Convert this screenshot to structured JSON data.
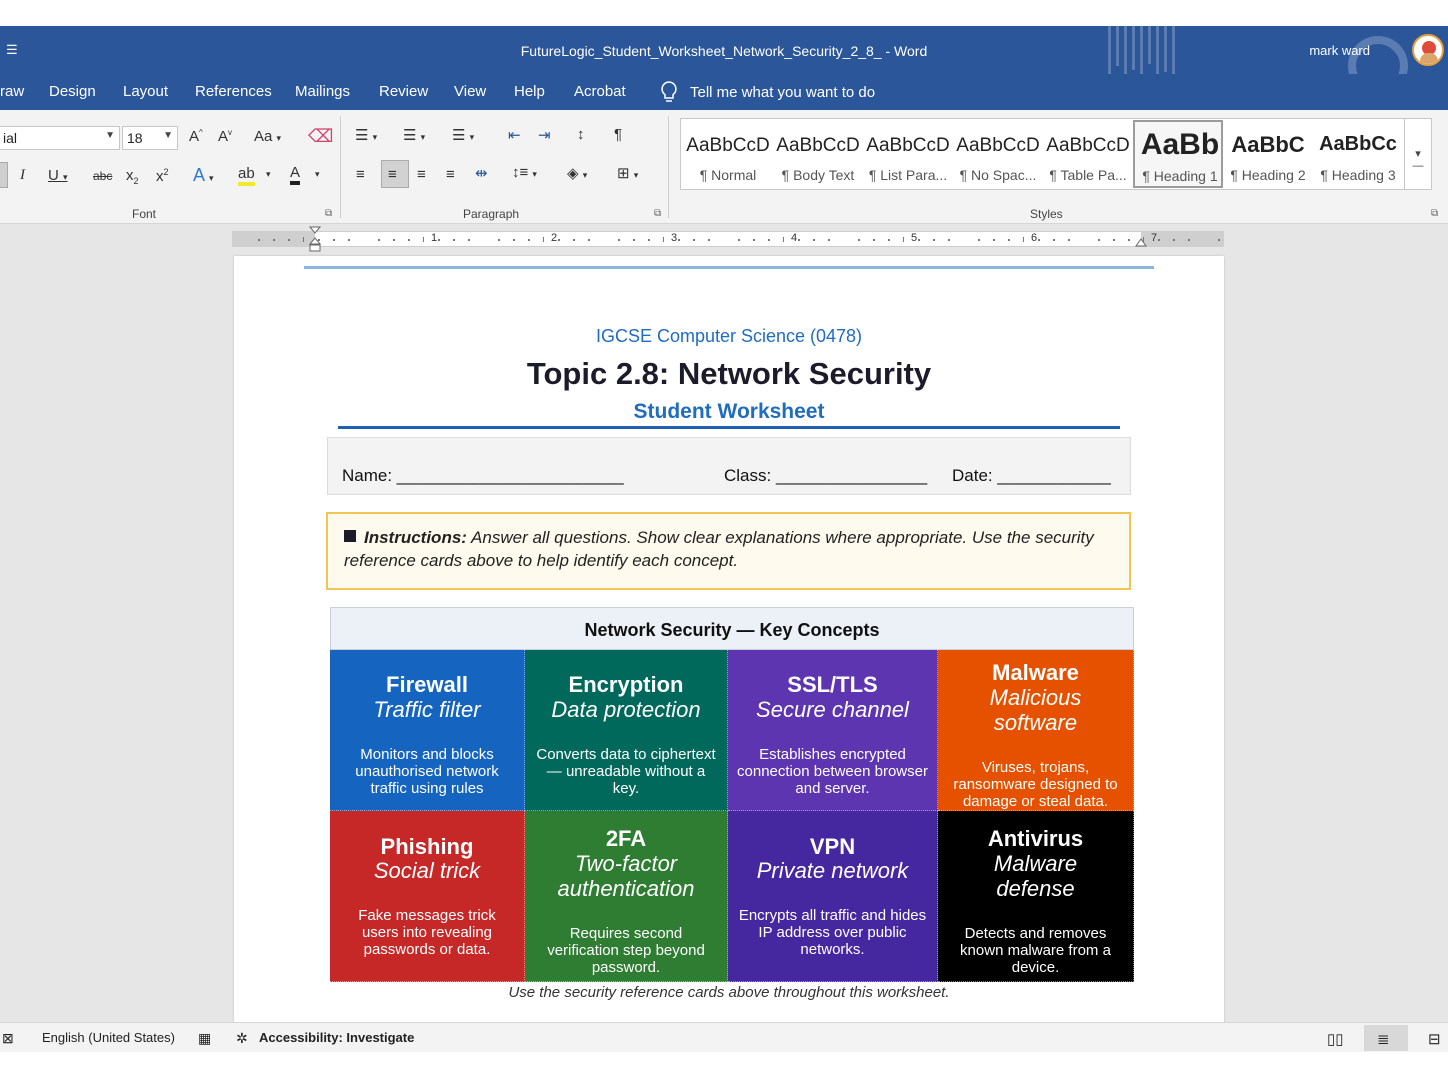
{
  "window": {
    "qat_glyph": "☰",
    "title": "FutureLogic_Student_Worksheet_Network_Security_2_8_  -  Word",
    "user_name": "mark ward"
  },
  "menu": {
    "tabs": [
      "raw",
      "Design",
      "Layout",
      "References",
      "Mailings",
      "Review",
      "View",
      "Help",
      "Acrobat"
    ],
    "tell_me": "Tell me what you want to do"
  },
  "ribbon": {
    "font_name": "ial",
    "font_size": "18",
    "font_group_label": "Font",
    "paragraph_group_label": "Paragraph",
    "styles_group_label": "Styles",
    "styles": [
      {
        "sample": "AaBbCcD",
        "name": "¶ Normal"
      },
      {
        "sample": "AaBbCcD",
        "name": "¶ Body Text"
      },
      {
        "sample": "AaBbCcD",
        "name": "¶ List Para..."
      },
      {
        "sample": "AaBbCcD",
        "name": "¶ No Spac..."
      },
      {
        "sample": "AaBbCcD",
        "name": "¶ Table Pa..."
      },
      {
        "sample": "AaBb",
        "name": "¶ Heading 1"
      },
      {
        "sample": "AaBbC",
        "name": "¶ Heading 2"
      },
      {
        "sample": "AaBbCc",
        "name": "¶ Heading 3"
      }
    ],
    "selected_style_index": 5
  },
  "ruler": {
    "numbers": [
      "1",
      "2",
      "3",
      "4",
      "5",
      "6",
      "7"
    ]
  },
  "document": {
    "course": "IGCSE Computer Science (0478)",
    "topic": "Topic 2.8: Network Security",
    "subtitle": "Student Worksheet",
    "name_label": "Name: ________________________",
    "class_label": "Class: ________________",
    "date_label": "Date: ____________",
    "instructions_bold": "Instructions:",
    "instructions_text": " Answer all questions. Show clear explanations where appropriate. Use the security reference cards above to help identify each concept.",
    "table_header": "Network Security — Key Concepts",
    "cards": [
      {
        "name": "Firewall",
        "sub": "Traffic filter",
        "desc": "Monitors and blocks unauthorised  network traffic using rules",
        "color": "#1565c0"
      },
      {
        "name": "Encryption",
        "sub": "Data protection",
        "desc": "Converts data to ciphertext  —  unreadable without a key.",
        "color": "#00695c"
      },
      {
        "name": "SSL/TLS",
        "sub": "Secure channel",
        "desc": "Establishes encrypted connection  between browser and server.",
        "color": "#5e35b1"
      },
      {
        "name": "Malware",
        "sub": "Malicious software",
        "desc": "Viruses, trojans, ransomware designed to damage or steal data.",
        "color": "#e65100"
      },
      {
        "name": "Phishing",
        "sub": "Social trick",
        "desc": "Fake messages trick users into  revealing passwords or data.",
        "color": "#c62828"
      },
      {
        "name": "2FA",
        "sub": "Two-factor authentication",
        "desc": "Requires second verification step  beyond password.",
        "color": "#2e7d32"
      },
      {
        "name": "VPN",
        "sub": "Private network",
        "desc": "Encrypts all traffic and hides IP address  over public networks.",
        "color": "#4527a0"
      },
      {
        "name": "Antivirus",
        "sub": "Malware defense",
        "desc": "Detects and removes known malware  from a device.",
        "color": "#000000"
      }
    ],
    "caption": "Use the security reference cards above throughout this worksheet."
  },
  "status": {
    "language": "English (United States)",
    "accessibility": "Accessibility: Investigate"
  },
  "colors": {
    "word_blue": "#2b579a",
    "accent_blue": "#1f6cc1",
    "instr_border": "#f3c552"
  }
}
